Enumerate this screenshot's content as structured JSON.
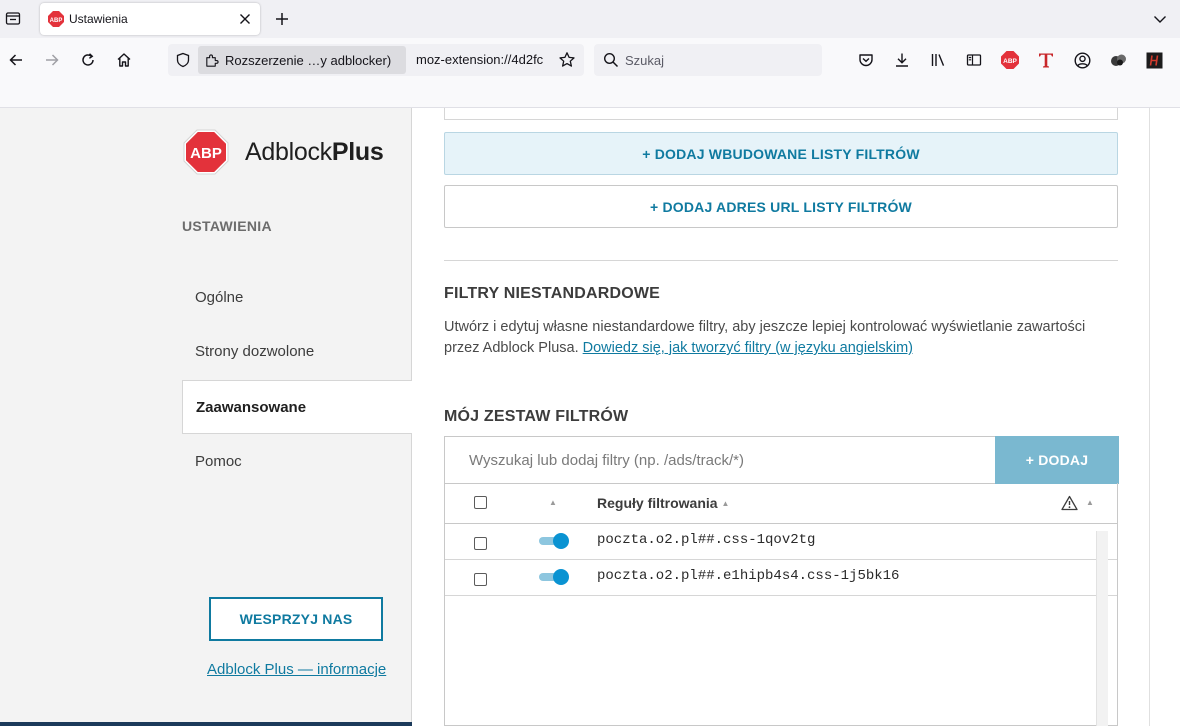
{
  "browser": {
    "tab": {
      "title": "Ustawienia"
    },
    "urlbar": {
      "identity_label": "Rozszerzenie …y adblocker)",
      "url": "moz-extension://4d2fc"
    },
    "search": {
      "placeholder": "Szukaj"
    }
  },
  "brand": {
    "logo_text": "ABP",
    "name_regular": "Adblock",
    "name_bold": "Plus"
  },
  "sidebar": {
    "heading": "USTAWIENIA",
    "items": [
      {
        "label": "Ogólne"
      },
      {
        "label": "Strony dozwolone"
      },
      {
        "label": "Zaawansowane"
      },
      {
        "label": "Pomoc"
      }
    ],
    "support_button": "WESPRZYJ NAS",
    "about_link": "Adblock Plus — informacje"
  },
  "main": {
    "add_builtin_lists_button": "+ DODAJ WBUDOWANE LISTY FILTRÓW",
    "add_url_list_button": "+ DODAJ ADRES URL LISTY FILTRÓW",
    "custom_filters": {
      "title": "FILTRY NIESTANDARDOWE",
      "description": "Utwórz i edytuj własne niestandardowe filtry, aby jeszcze lepiej kontrolować wyświetlanie zawartości przez Adblock Plusa.",
      "learn_link": "Dowiedz się, jak tworzyć filtry (w języku angielskim)"
    },
    "my_filters": {
      "title": "MÓJ ZESTAW FILTRÓW",
      "input_placeholder": "Wyszukaj lub dodaj filtry (np. /ads/track/*)",
      "add_button": "+ DODAJ",
      "column_rules": "Reguły filtrowania",
      "rows": [
        {
          "rule": "poczta.o2.pl##.css-1qov2tg",
          "enabled": true
        },
        {
          "rule": "poczta.o2.pl##.e1hipb4s4.css-1j5bk16",
          "enabled": true
        }
      ]
    }
  }
}
